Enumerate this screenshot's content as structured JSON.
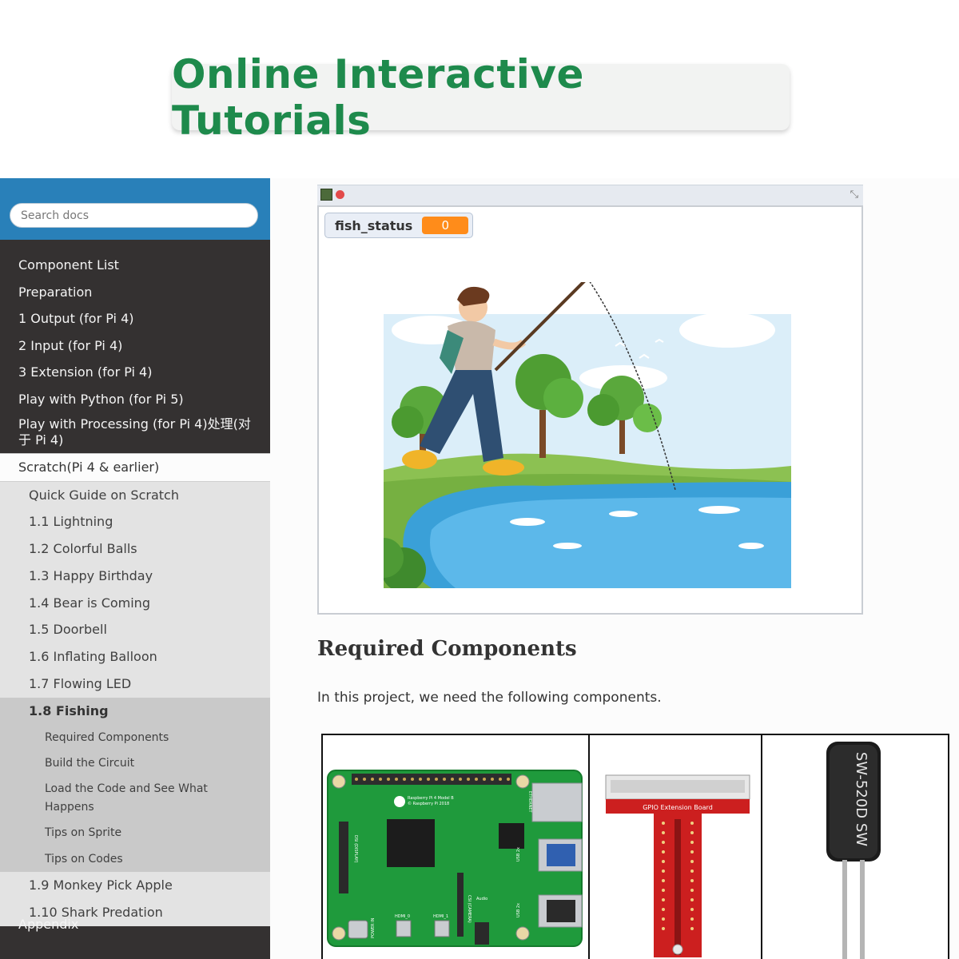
{
  "banner": {
    "title": "Online Interactive Tutorials"
  },
  "search": {
    "placeholder": "Search docs"
  },
  "nav": {
    "top_items": [
      "Component List",
      "Preparation",
      "1 Output (for Pi 4)",
      "2 Input (for Pi 4)",
      "3 Extension (for Pi 4)",
      "Play with Python (for Pi 5)",
      "Play with Processing (for Pi 4)处理(对于 Pi 4)"
    ],
    "current": "Scratch(Pi 4 & earlier)",
    "sub_items_before": [
      "Quick Guide on Scratch",
      "1.1 Lightning",
      "1.2 Colorful Balls",
      "1.3 Happy Birthday",
      "1.4 Bear is Coming",
      "1.5 Doorbell",
      "1.6 Inflating Balloon",
      "1.7 Flowing LED"
    ],
    "active_item": "1.8 Fishing",
    "active_children": [
      "Required Components",
      "Build the Circuit",
      "Load the Code and See What Happens",
      "Tips on Sprite",
      "Tips on Codes"
    ],
    "sub_items_after": [
      "1.9 Monkey Pick Apple",
      "1.10 Shark Predation"
    ],
    "appendix": "Appendix"
  },
  "stage": {
    "monitor_label": "fish_status",
    "monitor_value": "0"
  },
  "content": {
    "section_title": "Required Components",
    "paragraph": "In this project, we need the following components."
  },
  "components": {
    "pi_labels": [
      "Raspberry Pi 4 Model B",
      "© Raspberry Pi 2018",
      "ETHERNET",
      "USB 2x",
      "USB 2x",
      "DSI (DISPLAY)",
      "POWER IN",
      "HDMI_0",
      "HDMI_1",
      "CSI (CAMERA)",
      "Audio"
    ],
    "gpio_board_label": "GPIO Extension Board",
    "sensor_label": "SW-520D SW"
  },
  "colors": {
    "accent_green": "#1e8a4c",
    "sidebar_blue": "#2980b9",
    "sidebar_dark": "#343131",
    "monitor_orange": "#ff8c1a"
  }
}
